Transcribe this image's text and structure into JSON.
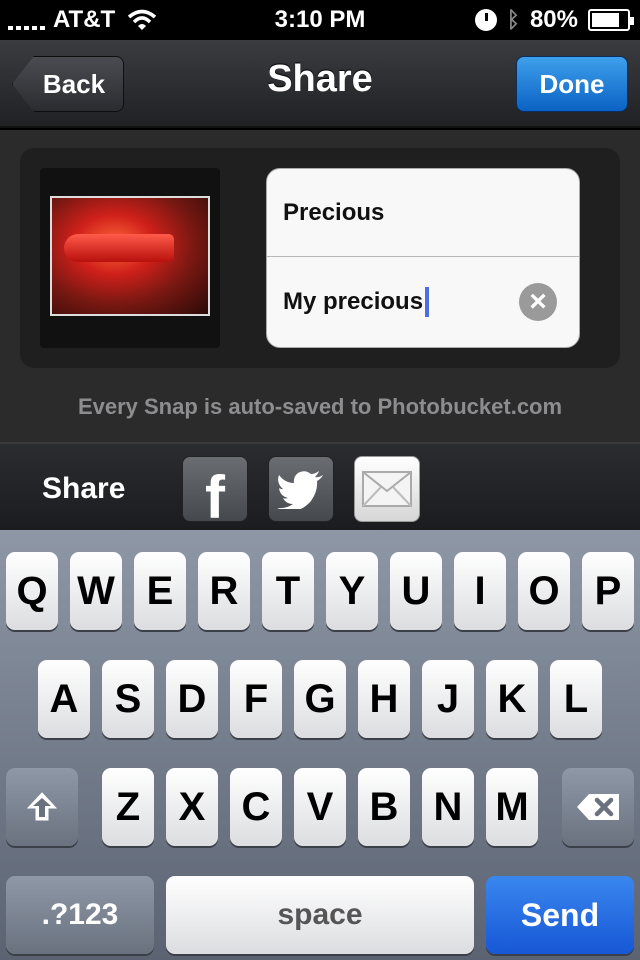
{
  "status_bar": {
    "carrier": "AT&T",
    "time": "3:10 PM",
    "battery": "80%",
    "battery_level": 0.8,
    "signal_icon": "signal-bars-icon",
    "wifi_icon": "wifi-icon",
    "clock_icon": "alarm-clock-icon",
    "bluetooth_icon": "bluetooth-icon",
    "battery_icon": "battery-icon"
  },
  "nav": {
    "back_label": "Back",
    "title": "Share",
    "done_label": "Done"
  },
  "form": {
    "title_value": "Precious",
    "caption_value": "My precious",
    "clear_icon": "clear-x-icon"
  },
  "autosave_note": "Every Snap is auto-saved to Photobucket.com",
  "share_bar": {
    "label": "Share",
    "services": [
      {
        "name": "facebook",
        "icon": "facebook-icon"
      },
      {
        "name": "twitter",
        "icon": "twitter-bird-icon"
      },
      {
        "name": "email",
        "icon": "mail-envelope-icon"
      }
    ]
  },
  "keyboard": {
    "row1": [
      "Q",
      "W",
      "E",
      "R",
      "T",
      "Y",
      "U",
      "I",
      "O",
      "P"
    ],
    "row2": [
      "A",
      "S",
      "D",
      "F",
      "G",
      "H",
      "J",
      "K",
      "L"
    ],
    "row3": [
      "Z",
      "X",
      "C",
      "V",
      "B",
      "N",
      "M"
    ],
    "shift_icon": "shift-arrow-icon",
    "delete_icon": "backspace-icon",
    "numbers_label": ".?123",
    "space_label": "space",
    "send_label": "Send"
  },
  "colors": {
    "done_button": "#1a73d6",
    "send_key": "#1f63de",
    "cursor": "#4b6fe2"
  }
}
